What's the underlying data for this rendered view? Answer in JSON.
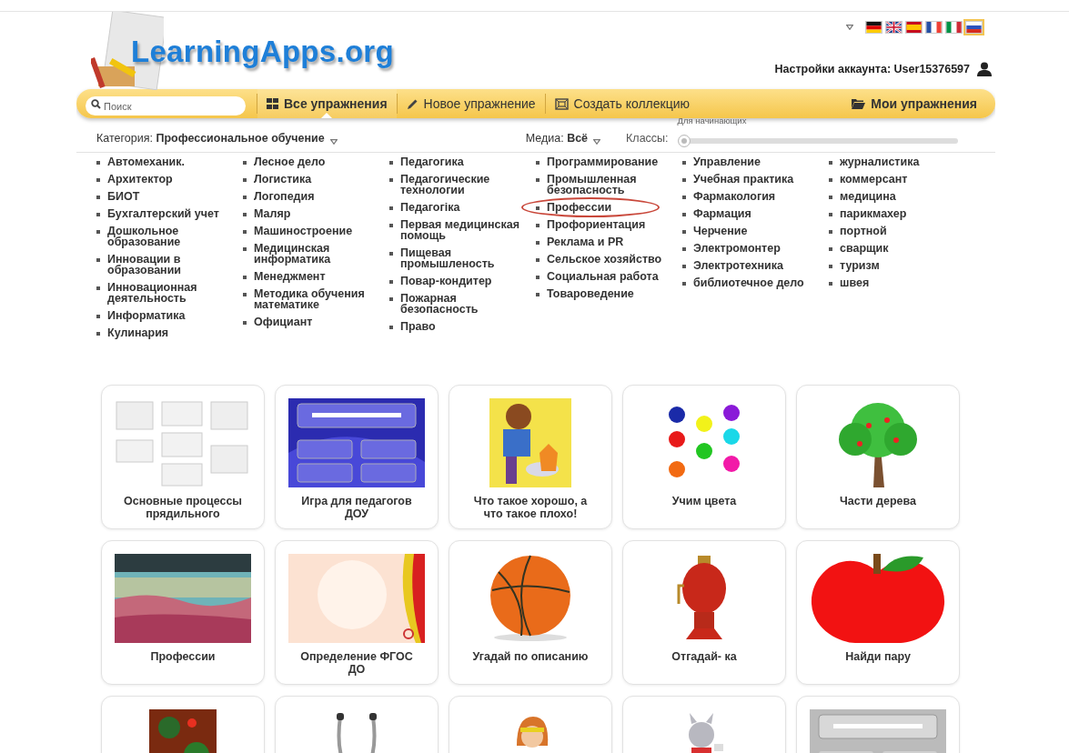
{
  "header": {
    "logo": "LearningApps.org",
    "account_label": "Настройки аккаунта:",
    "user": "User15376597"
  },
  "flags": [
    {
      "kind": "de",
      "selected": false
    },
    {
      "kind": "gb",
      "selected": false
    },
    {
      "kind": "es",
      "selected": false
    },
    {
      "kind": "fr",
      "selected": false
    },
    {
      "kind": "it",
      "selected": false
    },
    {
      "kind": "ru",
      "selected": true
    }
  ],
  "search": {
    "placeholder": "Поиск"
  },
  "nav": [
    {
      "label": "Все упражнения",
      "kind": "grid",
      "selected": true
    },
    {
      "label": "Новое упражнение",
      "kind": "pencil",
      "selected": false
    },
    {
      "label": "Создать коллекцию",
      "kind": "collection",
      "selected": false
    },
    {
      "label": "Мои упражнения",
      "kind": "folder",
      "selected": false
    }
  ],
  "filters": {
    "category_label": "Категория:",
    "category": "Профессиональное обучение",
    "media_label": "Медиа:",
    "media": "Всё",
    "classes_label": "Классы:",
    "level_label": "Для начинающих",
    "level": 0
  },
  "categories": [
    [
      {
        "label": "Автомеханик.",
        "highlighted": false
      },
      {
        "label": "Архитектор",
        "highlighted": false
      },
      {
        "label": "БИОТ",
        "highlighted": false
      },
      {
        "label": "Бухгалтерский учет",
        "highlighted": false
      },
      {
        "label": "Дошкольное образование",
        "highlighted": false
      },
      {
        "label": "Инновации в образовании",
        "highlighted": false
      },
      {
        "label": "Инновационная деятельность",
        "highlighted": false
      },
      {
        "label": "Информатика",
        "highlighted": false
      },
      {
        "label": "Кулинария",
        "highlighted": false
      }
    ],
    [
      {
        "label": "Лесное дело",
        "highlighted": false
      },
      {
        "label": "Логистика",
        "highlighted": false
      },
      {
        "label": "Логопедия",
        "highlighted": false
      },
      {
        "label": "Маляр",
        "highlighted": false
      },
      {
        "label": "Машиностроение",
        "highlighted": false
      },
      {
        "label": "Медицинская информатика",
        "highlighted": false
      },
      {
        "label": "Менеджмент",
        "highlighted": false
      },
      {
        "label": "Методика обучения математике",
        "highlighted": false
      },
      {
        "label": "Официант",
        "highlighted": false
      }
    ],
    [
      {
        "label": "Педагогика",
        "highlighted": false
      },
      {
        "label": "Педагогические технологии",
        "highlighted": false
      },
      {
        "label": "Педагогiка",
        "highlighted": false
      },
      {
        "label": "Первая медицинская помощь",
        "highlighted": false
      },
      {
        "label": "Пищевая промышленость",
        "highlighted": false
      },
      {
        "label": "Повар-кондитер",
        "highlighted": false
      },
      {
        "label": "Пожарная безопасность",
        "highlighted": false
      },
      {
        "label": "Право",
        "highlighted": false
      }
    ],
    [
      {
        "label": "Программирование",
        "highlighted": false
      },
      {
        "label": "Промышленная безопасность",
        "highlighted": false
      },
      {
        "label": "Профессии",
        "highlighted": true
      },
      {
        "label": "Профориентация",
        "highlighted": false
      },
      {
        "label": "Реклама и PR",
        "highlighted": false
      },
      {
        "label": "Сельское хозяйство",
        "highlighted": false
      },
      {
        "label": "Социальная работа",
        "highlighted": false
      },
      {
        "label": "Товароведение",
        "highlighted": false
      }
    ],
    [
      {
        "label": "Управление",
        "highlighted": false
      },
      {
        "label": "Учебная практика",
        "highlighted": false
      },
      {
        "label": "Фармакология",
        "highlighted": false
      },
      {
        "label": "Фармация",
        "highlighted": false
      },
      {
        "label": "Черчение",
        "highlighted": false
      },
      {
        "label": "Электромонтер",
        "highlighted": false
      },
      {
        "label": "Электротехника",
        "highlighted": false
      },
      {
        "label": "библиотечное дело",
        "highlighted": false
      }
    ],
    [
      {
        "label": "журналистика",
        "highlighted": false
      },
      {
        "label": "коммерсант",
        "highlighted": false
      },
      {
        "label": "медицина",
        "highlighted": false
      },
      {
        "label": "парикмахер",
        "highlighted": false
      },
      {
        "label": "портной",
        "highlighted": false
      },
      {
        "label": "сварщик",
        "highlighted": false
      },
      {
        "label": "туризм",
        "highlighted": false
      },
      {
        "label": "швея",
        "highlighted": false
      }
    ]
  ],
  "exercises": [
    {
      "title": "Основные процессы прядильного"
    },
    {
      "title": "Игра для педагогов ДОУ"
    },
    {
      "title": "Что такое хорошо, а что такое плохо!"
    },
    {
      "title": "Учим цвета"
    },
    {
      "title": "Части дерева"
    },
    {
      "title": "Профессии"
    },
    {
      "title": "Определение ФГОС ДО"
    },
    {
      "title": "Угадай по описанию"
    },
    {
      "title": "Отгадай- ка"
    },
    {
      "title": "Найди пару"
    },
    {
      "kind": "picture"
    },
    {
      "kind": "picture"
    },
    {
      "kind": "picture"
    },
    {
      "kind": "picture"
    },
    {
      "kind": "picture"
    }
  ]
}
